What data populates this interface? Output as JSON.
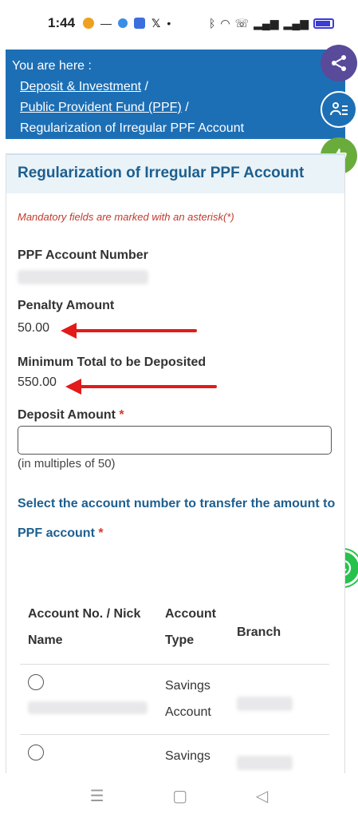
{
  "status_bar": {
    "time": "1:44",
    "icons_left": [
      "app-icon",
      "minus-icon",
      "app-icon",
      "app-icon",
      "x-icon",
      "dot-icon"
    ],
    "icons_right": [
      "bluetooth-icon",
      "wifi-icon",
      "call-icon",
      "signal-icon",
      "signal-icon",
      "battery-icon"
    ]
  },
  "breadcrumb": {
    "prefix": "You are here :",
    "items": [
      {
        "label": "Deposit & Investment",
        "sep": "/"
      },
      {
        "label": "Public Provident Fund (PPF)",
        "sep": "/"
      },
      {
        "label": "Regularization of Irregular PPF Account",
        "sep": ""
      }
    ]
  },
  "card": {
    "title": "Regularization of Irregular PPF Account",
    "mandatory_note": "Mandatory fields are marked with an asterisk(*)",
    "ppf_account": {
      "label": "PPF Account Number"
    },
    "penalty": {
      "label": "Penalty Amount",
      "value": "50.00"
    },
    "minimum_total": {
      "label": "Minimum Total to be Deposited",
      "value": "550.00"
    },
    "deposit": {
      "label": "Deposit Amount",
      "asterisk": "*",
      "value": "",
      "hint": "(in multiples of 50)"
    },
    "select_account": {
      "label": "Select the account number to transfer the amount to PPF account",
      "asterisk": "*"
    },
    "table": {
      "headers": [
        "Account No. / Nick Name",
        "Account Type",
        "Branch"
      ],
      "rows": [
        {
          "type": "Savings Account"
        },
        {
          "type": "Savings"
        }
      ]
    }
  },
  "colors": {
    "brand_blue": "#1d6fb5",
    "title_blue": "#1d5f8f",
    "error_red": "#c23a2c",
    "arrow_red": "#e21a1a",
    "whatsapp_green": "#27c24c"
  },
  "nav": {
    "icons": [
      "menu-icon",
      "home-icon",
      "back-icon"
    ]
  }
}
